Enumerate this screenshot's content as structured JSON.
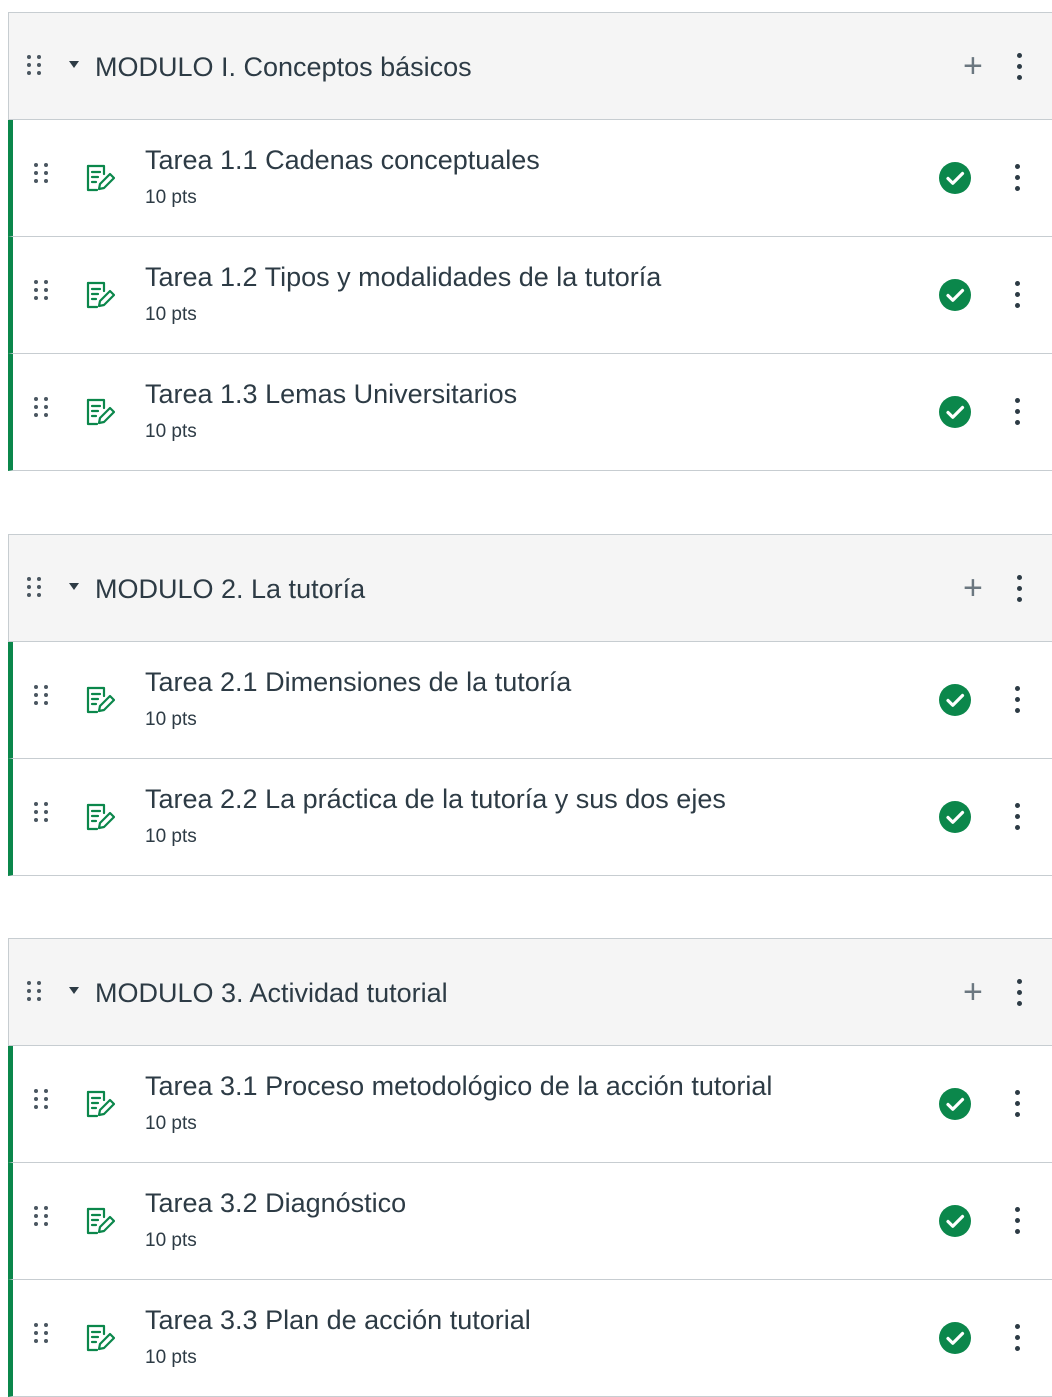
{
  "modules": [
    {
      "title": "MODULO I. Conceptos básicos",
      "items": [
        {
          "name": "Tarea 1.1 Cadenas conceptuales",
          "points": "10 pts",
          "status": "complete"
        },
        {
          "name": "Tarea 1.2 Tipos y modalidades de la tutoría",
          "points": "10 pts",
          "status": "complete"
        },
        {
          "name": "Tarea 1.3 Lemas Universitarios",
          "points": "10 pts",
          "status": "complete"
        }
      ]
    },
    {
      "title": "MODULO 2. La tutoría",
      "items": [
        {
          "name": "Tarea 2.1 Dimensiones de la tutoría",
          "points": "10 pts",
          "status": "complete"
        },
        {
          "name": "Tarea 2.2 La práctica de la tutoría y sus dos ejes",
          "points": "10 pts",
          "status": "complete"
        }
      ]
    },
    {
      "title": "MODULO 3. Actividad tutorial",
      "items": [
        {
          "name": "Tarea 3.1 Proceso metodológico de la acción tutorial",
          "points": "10 pts",
          "status": "complete"
        },
        {
          "name": "Tarea 3.2 Diagnóstico",
          "points": "10 pts",
          "status": "complete"
        },
        {
          "name": "Tarea 3.3 Plan de acción tutorial",
          "points": "10 pts",
          "status": "complete"
        }
      ]
    }
  ],
  "icons": {
    "drag": "drag-handle-icon",
    "collapse": "caret-down-icon",
    "add": "plus-icon",
    "menu": "kebab-menu-icon",
    "assignment": "assignment-icon",
    "complete": "check-circle-icon"
  },
  "colors": {
    "accent_green": "#0b874b",
    "text": "#2d3b45",
    "header_bg": "#f5f5f5",
    "border": "#c7cdd1"
  },
  "ui": {
    "add_symbol": "+"
  }
}
